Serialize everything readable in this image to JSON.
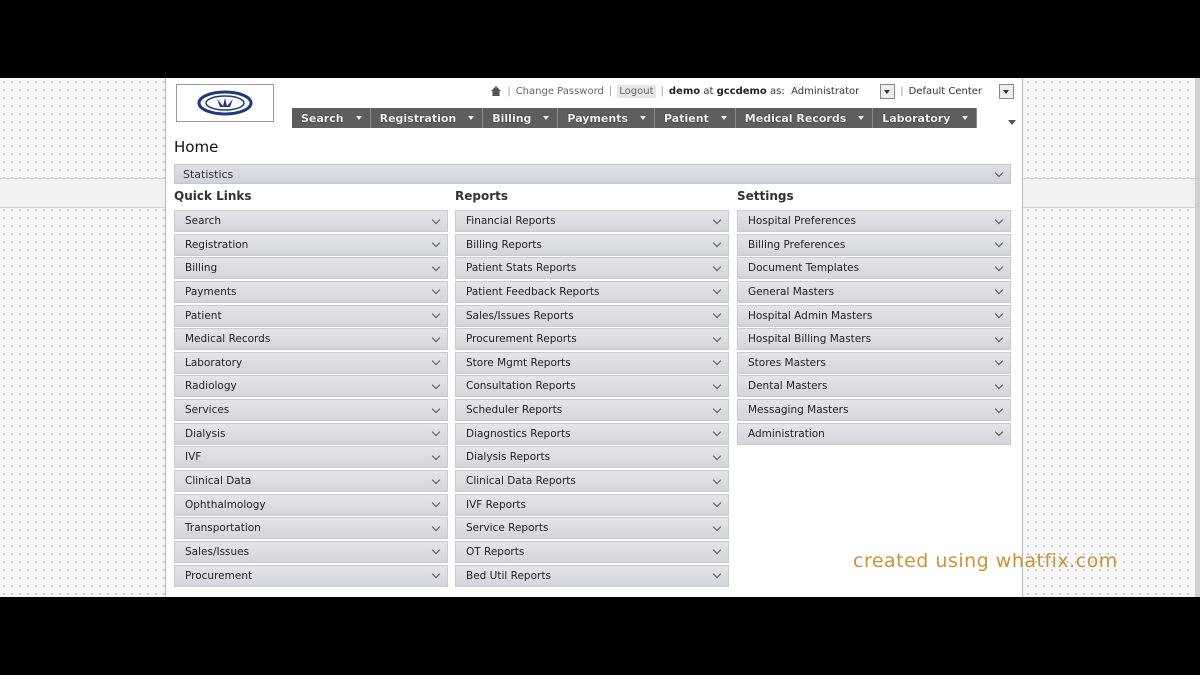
{
  "header": {
    "change_password": "Change Password",
    "logout": "Logout",
    "user": "demo",
    "at_label": "at",
    "org": "gccdemo",
    "as_label": "as:",
    "role": "Administrator",
    "center": "Default Center",
    "separator": "|"
  },
  "nav": {
    "items": [
      {
        "label": "Search"
      },
      {
        "label": "Registration"
      },
      {
        "label": "Billing"
      },
      {
        "label": "Payments"
      },
      {
        "label": "Patient"
      },
      {
        "label": "Medical Records"
      },
      {
        "label": "Laboratory"
      }
    ]
  },
  "page": {
    "title": "Home",
    "statistics": "Statistics"
  },
  "columns": {
    "quick_links": {
      "heading": "Quick Links",
      "items": [
        "Search",
        "Registration",
        "Billing",
        "Payments",
        "Patient",
        "Medical Records",
        "Laboratory",
        "Radiology",
        "Services",
        "Dialysis",
        "IVF",
        "Clinical Data",
        "Ophthalmology",
        "Transportation",
        "Sales/Issues",
        "Procurement"
      ]
    },
    "reports": {
      "heading": "Reports",
      "items": [
        "Financial Reports",
        "Billing Reports",
        "Patient Stats Reports",
        "Patient Feedback Reports",
        "Sales/Issues Reports",
        "Procurement Reports",
        "Store Mgmt Reports",
        "Consultation Reports",
        "Scheduler Reports",
        "Diagnostics Reports",
        "Dialysis Reports",
        "Clinical Data Reports",
        "IVF Reports",
        "Service Reports",
        "OT Reports",
        "Bed Util Reports"
      ]
    },
    "settings": {
      "heading": "Settings",
      "items": [
        "Hospital Preferences",
        "Billing Preferences",
        "Document Templates",
        "General Masters",
        "Hospital Admin Masters",
        "Hospital Billing Masters",
        "Stores Masters",
        "Dental Masters",
        "Messaging Masters",
        "Administration"
      ]
    }
  },
  "watermark": "created using whatfix.com",
  "colors": {
    "nav_bg": "#5e5e5e",
    "accordion_bg": "#d9dce1",
    "watermark": "#c8933a"
  }
}
